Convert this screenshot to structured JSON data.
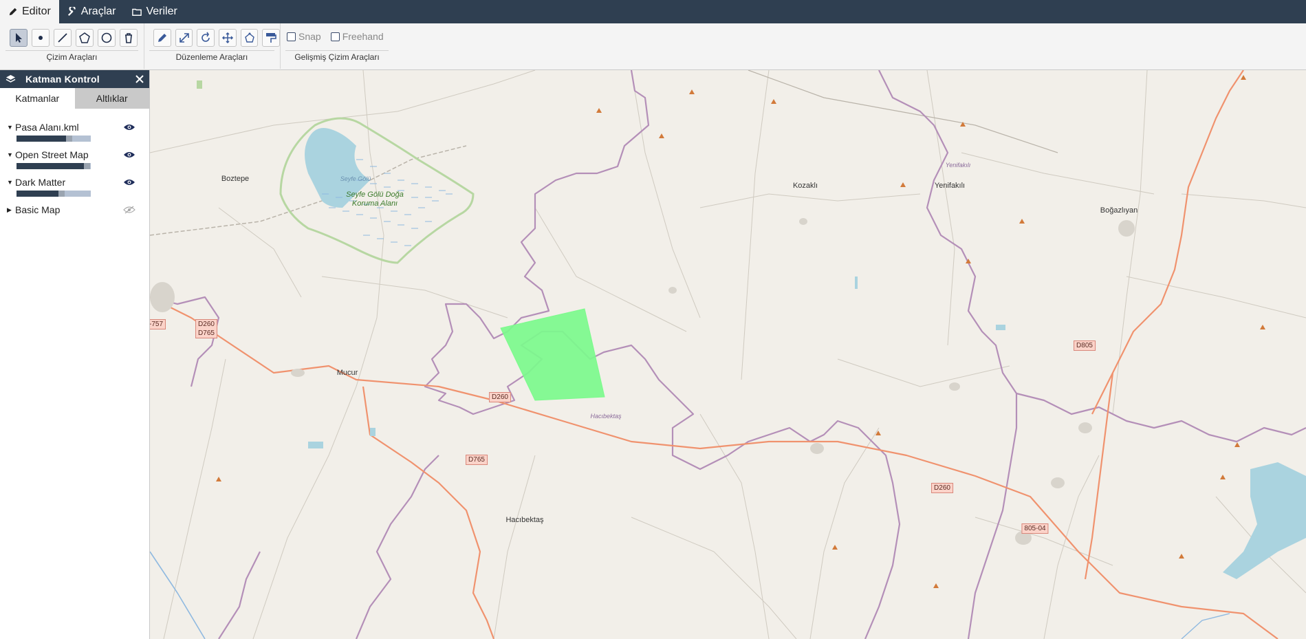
{
  "menu": {
    "tabs": [
      {
        "label": "Editor",
        "icon": "pencil-icon"
      },
      {
        "label": "Araçlar",
        "icon": "wrench-icon"
      },
      {
        "label": "Veriler",
        "icon": "folder-icon"
      }
    ]
  },
  "toolbar": {
    "groups": [
      {
        "label": "Çizim Araçları",
        "tools": [
          "select-icon",
          "point-icon",
          "line-icon",
          "polygon-icon",
          "circle-icon",
          "trash-icon"
        ]
      },
      {
        "label": "Düzenleme Araçları",
        "tools": [
          "edit-icon",
          "scale-icon",
          "rotate-icon",
          "move-icon",
          "polygon-edit-icon",
          "paint-roller-icon"
        ]
      },
      {
        "label": "Gelişmiş Çizim Araçları",
        "checkboxes": [
          "Snap",
          "Freehand"
        ]
      }
    ]
  },
  "panel": {
    "title": "Katman Kontrol",
    "tabs": [
      "Katmanlar",
      "Altlıklar"
    ],
    "layers": [
      {
        "name": "Pasa Alanı.kml",
        "visible": true,
        "opacity": 0.67
      },
      {
        "name": "Open Street Map",
        "visible": true,
        "opacity": 0.9
      },
      {
        "name": "Dark Matter",
        "visible": true,
        "opacity": 0.56
      },
      {
        "name": "Basic Map",
        "visible": false
      }
    ]
  },
  "map": {
    "places": [
      "Boztepe",
      "Seyfe Gölü",
      "Seyfe Gölü Doğa Koruma Alanı",
      "Mucur",
      "Kozaklı",
      "Yenifakılı",
      "Yenifakılı",
      "Boğazlıyan",
      "Hacıbektaş",
      "Hacıbektaş"
    ],
    "roads": [
      "D260",
      "D765",
      "-757",
      "D260",
      "D765",
      "D260",
      "D805",
      "805-04"
    ]
  },
  "colors": {
    "header": "#2f3f51",
    "polygon": "#7cfa8c",
    "road": "#f0926e",
    "boundary": "#b48fb8"
  }
}
